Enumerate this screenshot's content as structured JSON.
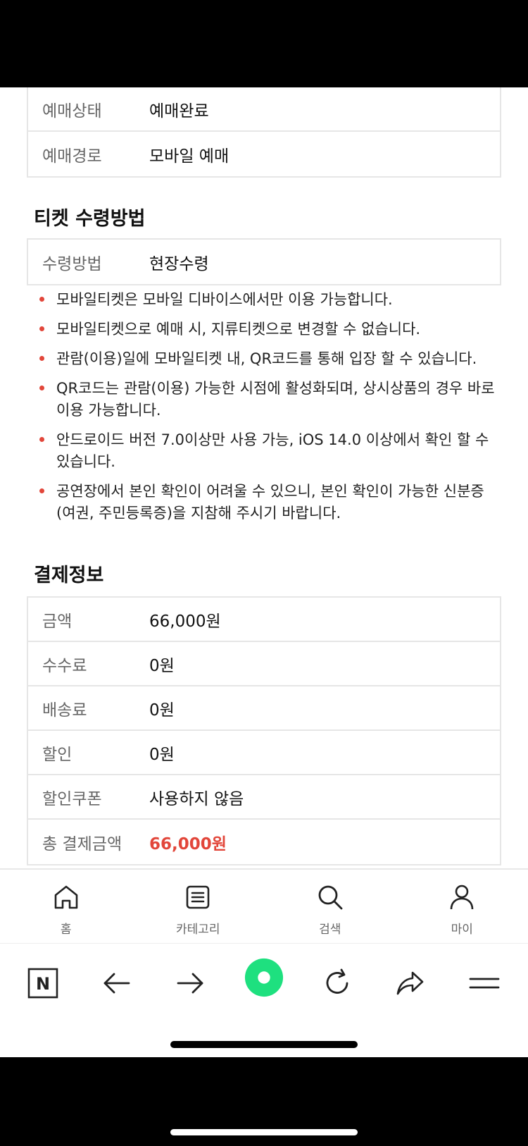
{
  "booking_table": [
    {
      "label": "예매상태",
      "value": "예매완료"
    },
    {
      "label": "예매경로",
      "value": "모바일 예매"
    }
  ],
  "ticket_section": {
    "title": "티켓 수령방법",
    "rows": [
      {
        "label": "수령방법",
        "value": "현장수령"
      }
    ],
    "notes": [
      "모바일티켓은 모바일 디바이스에서만 이용 가능합니다.",
      "모바일티켓으로 예매 시, 지류티켓으로 변경할 수 없습니다.",
      "관람(이용)일에 모바일티켓 내, QR코드를 통해 입장 할 수 있습니다.",
      "QR코드는 관람(이용) 가능한 시점에 활성화되며, 상시상품의 경우 바로 이용 가능합니다.",
      "안드로이드 버전 7.0이상만 사용 가능, iOS 14.0 이상에서 확인 할 수 있습니다.",
      "공연장에서 본인 확인이 어려울 수 있으니, 본인 확인이 가능한 신분증(여권, 주민등록증)을 지참해 주시기 바랍니다."
    ]
  },
  "payment_section": {
    "title": "결제정보",
    "rows": [
      {
        "label": "금액",
        "value": "66,000원"
      },
      {
        "label": "수수료",
        "value": "0원"
      },
      {
        "label": "배송료",
        "value": "0원"
      },
      {
        "label": "할인",
        "value": "0원"
      },
      {
        "label": "할인쿠폰",
        "value": "사용하지 않음"
      },
      {
        "label": "총 결제금액",
        "value": "66,000원"
      }
    ]
  },
  "bottom_nav": [
    {
      "label": "홈",
      "icon": "home-icon"
    },
    {
      "label": "카테고리",
      "icon": "category-icon"
    },
    {
      "label": "검색",
      "icon": "search-icon"
    },
    {
      "label": "마이",
      "icon": "person-icon"
    }
  ],
  "browser_toolbar": {
    "logo_letter": "N",
    "accent_color": "#1ee07f"
  },
  "colors": {
    "accent_red": "#e2463a",
    "border": "#e6e6e6"
  }
}
